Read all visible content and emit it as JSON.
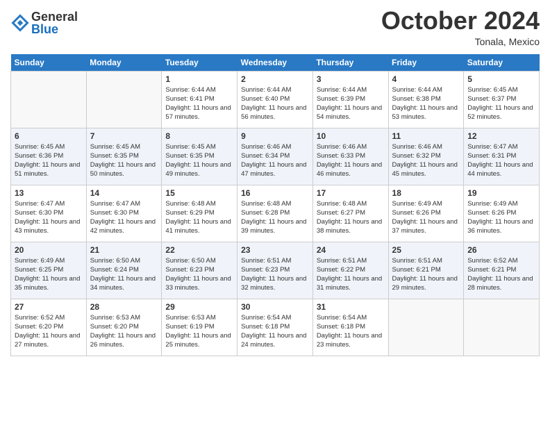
{
  "header": {
    "logo_general": "General",
    "logo_blue": "Blue",
    "month": "October 2024",
    "location": "Tonala, Mexico"
  },
  "days_of_week": [
    "Sunday",
    "Monday",
    "Tuesday",
    "Wednesday",
    "Thursday",
    "Friday",
    "Saturday"
  ],
  "weeks": [
    [
      {
        "day": "",
        "info": ""
      },
      {
        "day": "",
        "info": ""
      },
      {
        "day": "1",
        "info": "Sunrise: 6:44 AM\nSunset: 6:41 PM\nDaylight: 11 hours and 57 minutes."
      },
      {
        "day": "2",
        "info": "Sunrise: 6:44 AM\nSunset: 6:40 PM\nDaylight: 11 hours and 56 minutes."
      },
      {
        "day": "3",
        "info": "Sunrise: 6:44 AM\nSunset: 6:39 PM\nDaylight: 11 hours and 54 minutes."
      },
      {
        "day": "4",
        "info": "Sunrise: 6:44 AM\nSunset: 6:38 PM\nDaylight: 11 hours and 53 minutes."
      },
      {
        "day": "5",
        "info": "Sunrise: 6:45 AM\nSunset: 6:37 PM\nDaylight: 11 hours and 52 minutes."
      }
    ],
    [
      {
        "day": "6",
        "info": "Sunrise: 6:45 AM\nSunset: 6:36 PM\nDaylight: 11 hours and 51 minutes."
      },
      {
        "day": "7",
        "info": "Sunrise: 6:45 AM\nSunset: 6:35 PM\nDaylight: 11 hours and 50 minutes."
      },
      {
        "day": "8",
        "info": "Sunrise: 6:45 AM\nSunset: 6:35 PM\nDaylight: 11 hours and 49 minutes."
      },
      {
        "day": "9",
        "info": "Sunrise: 6:46 AM\nSunset: 6:34 PM\nDaylight: 11 hours and 47 minutes."
      },
      {
        "day": "10",
        "info": "Sunrise: 6:46 AM\nSunset: 6:33 PM\nDaylight: 11 hours and 46 minutes."
      },
      {
        "day": "11",
        "info": "Sunrise: 6:46 AM\nSunset: 6:32 PM\nDaylight: 11 hours and 45 minutes."
      },
      {
        "day": "12",
        "info": "Sunrise: 6:47 AM\nSunset: 6:31 PM\nDaylight: 11 hours and 44 minutes."
      }
    ],
    [
      {
        "day": "13",
        "info": "Sunrise: 6:47 AM\nSunset: 6:30 PM\nDaylight: 11 hours and 43 minutes."
      },
      {
        "day": "14",
        "info": "Sunrise: 6:47 AM\nSunset: 6:30 PM\nDaylight: 11 hours and 42 minutes."
      },
      {
        "day": "15",
        "info": "Sunrise: 6:48 AM\nSunset: 6:29 PM\nDaylight: 11 hours and 41 minutes."
      },
      {
        "day": "16",
        "info": "Sunrise: 6:48 AM\nSunset: 6:28 PM\nDaylight: 11 hours and 39 minutes."
      },
      {
        "day": "17",
        "info": "Sunrise: 6:48 AM\nSunset: 6:27 PM\nDaylight: 11 hours and 38 minutes."
      },
      {
        "day": "18",
        "info": "Sunrise: 6:49 AM\nSunset: 6:26 PM\nDaylight: 11 hours and 37 minutes."
      },
      {
        "day": "19",
        "info": "Sunrise: 6:49 AM\nSunset: 6:26 PM\nDaylight: 11 hours and 36 minutes."
      }
    ],
    [
      {
        "day": "20",
        "info": "Sunrise: 6:49 AM\nSunset: 6:25 PM\nDaylight: 11 hours and 35 minutes."
      },
      {
        "day": "21",
        "info": "Sunrise: 6:50 AM\nSunset: 6:24 PM\nDaylight: 11 hours and 34 minutes."
      },
      {
        "day": "22",
        "info": "Sunrise: 6:50 AM\nSunset: 6:23 PM\nDaylight: 11 hours and 33 minutes."
      },
      {
        "day": "23",
        "info": "Sunrise: 6:51 AM\nSunset: 6:23 PM\nDaylight: 11 hours and 32 minutes."
      },
      {
        "day": "24",
        "info": "Sunrise: 6:51 AM\nSunset: 6:22 PM\nDaylight: 11 hours and 31 minutes."
      },
      {
        "day": "25",
        "info": "Sunrise: 6:51 AM\nSunset: 6:21 PM\nDaylight: 11 hours and 29 minutes."
      },
      {
        "day": "26",
        "info": "Sunrise: 6:52 AM\nSunset: 6:21 PM\nDaylight: 11 hours and 28 minutes."
      }
    ],
    [
      {
        "day": "27",
        "info": "Sunrise: 6:52 AM\nSunset: 6:20 PM\nDaylight: 11 hours and 27 minutes."
      },
      {
        "day": "28",
        "info": "Sunrise: 6:53 AM\nSunset: 6:20 PM\nDaylight: 11 hours and 26 minutes."
      },
      {
        "day": "29",
        "info": "Sunrise: 6:53 AM\nSunset: 6:19 PM\nDaylight: 11 hours and 25 minutes."
      },
      {
        "day": "30",
        "info": "Sunrise: 6:54 AM\nSunset: 6:18 PM\nDaylight: 11 hours and 24 minutes."
      },
      {
        "day": "31",
        "info": "Sunrise: 6:54 AM\nSunset: 6:18 PM\nDaylight: 11 hours and 23 minutes."
      },
      {
        "day": "",
        "info": ""
      },
      {
        "day": "",
        "info": ""
      }
    ]
  ]
}
